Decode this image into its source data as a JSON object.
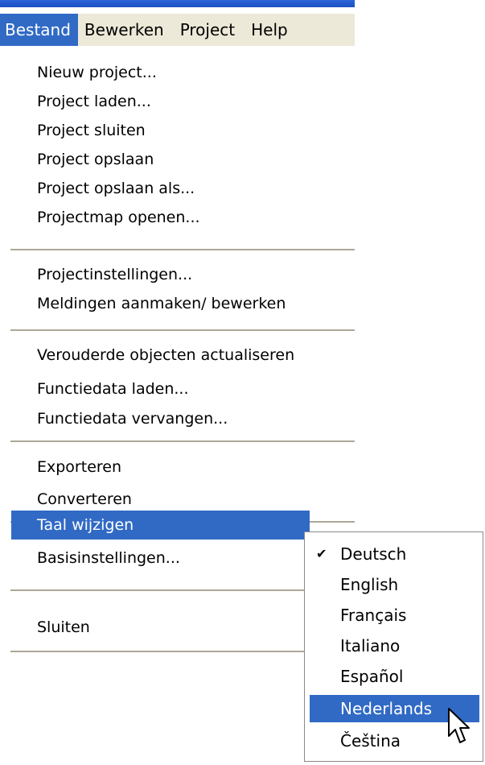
{
  "menubar": {
    "items": [
      "Bestand",
      "Bewerken",
      "Project",
      "Help"
    ],
    "active_index": 0
  },
  "file_menu": {
    "items": [
      "Nieuw project...",
      "Project laden...",
      "Project sluiten",
      "Project opslaan",
      "Project opslaan als...",
      "Projectmap openen...",
      "Projectinstellingen...",
      "Meldingen aanmaken/ bewerken",
      "Verouderde objecten actualiseren",
      "Functiedata laden...",
      "Functiedata vervangen...",
      "Exporteren",
      "Converteren",
      "Taal wijzigen",
      "Basisinstellingen...",
      "Sluiten"
    ],
    "highlighted_index": 13
  },
  "language_submenu": {
    "items": [
      "Deutsch",
      "English",
      "Français",
      "Italiano",
      "Español",
      "Nederlands",
      "Čeština"
    ],
    "checked_index": 0,
    "highlighted_index": 5
  },
  "icons": {
    "check": "checkmark-icon",
    "cursor": "mouse-pointer-icon"
  },
  "colors": {
    "highlight": "#316ac5",
    "menubar_bg": "#ece9d8",
    "separator": "#aca899"
  }
}
